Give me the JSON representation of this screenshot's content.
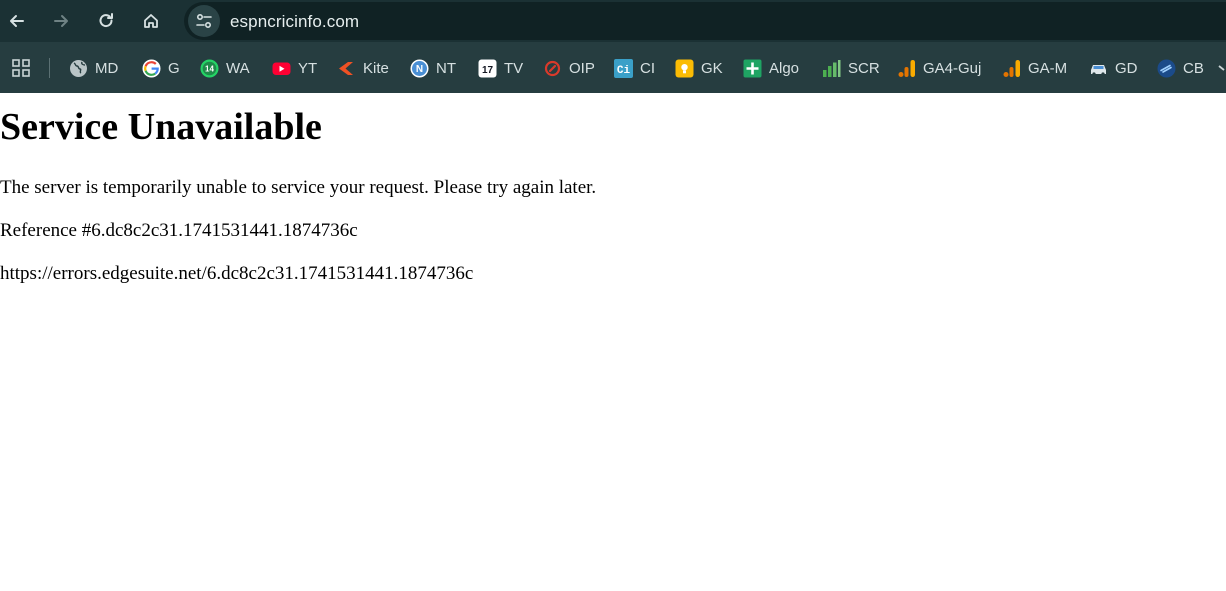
{
  "browser": {
    "url": "espncricinfo.com",
    "bookmarks": [
      {
        "label": "MD",
        "icon": "globe-icon"
      },
      {
        "label": "G",
        "icon": "google-icon"
      },
      {
        "label": "WA",
        "icon": "whatsapp-icon",
        "badge": "14"
      },
      {
        "label": "YT",
        "icon": "youtube-icon"
      },
      {
        "label": "Kite",
        "icon": "kite-icon"
      },
      {
        "label": "NT",
        "icon": "n-circle-icon",
        "badge": "N"
      },
      {
        "label": "TV",
        "icon": "tradingview-icon",
        "badge": "17"
      },
      {
        "label": "OIP",
        "icon": "oip-icon"
      },
      {
        "label": "CI",
        "icon": "ci-icon",
        "badge": "Ci"
      },
      {
        "label": "GK",
        "icon": "keep-icon"
      },
      {
        "label": "Algo",
        "icon": "sheets-plus-icon"
      },
      {
        "label": "SCR",
        "icon": "bars-green-icon"
      },
      {
        "label": "GA4-Guj",
        "icon": "analytics-icon"
      },
      {
        "label": "GA-M",
        "icon": "analytics-icon"
      },
      {
        "label": "GD",
        "icon": "car-icon"
      },
      {
        "label": "CB",
        "icon": "cb-icon"
      }
    ]
  },
  "page": {
    "title": "Service Unavailable",
    "message": "The server is temporarily unable to service your request. Please try again later.",
    "reference": "Reference #6.dc8c2c31.1741531441.1874736c",
    "error_url": "https://errors.edgesuite.net/6.dc8c2c31.1741531441.1874736c"
  }
}
